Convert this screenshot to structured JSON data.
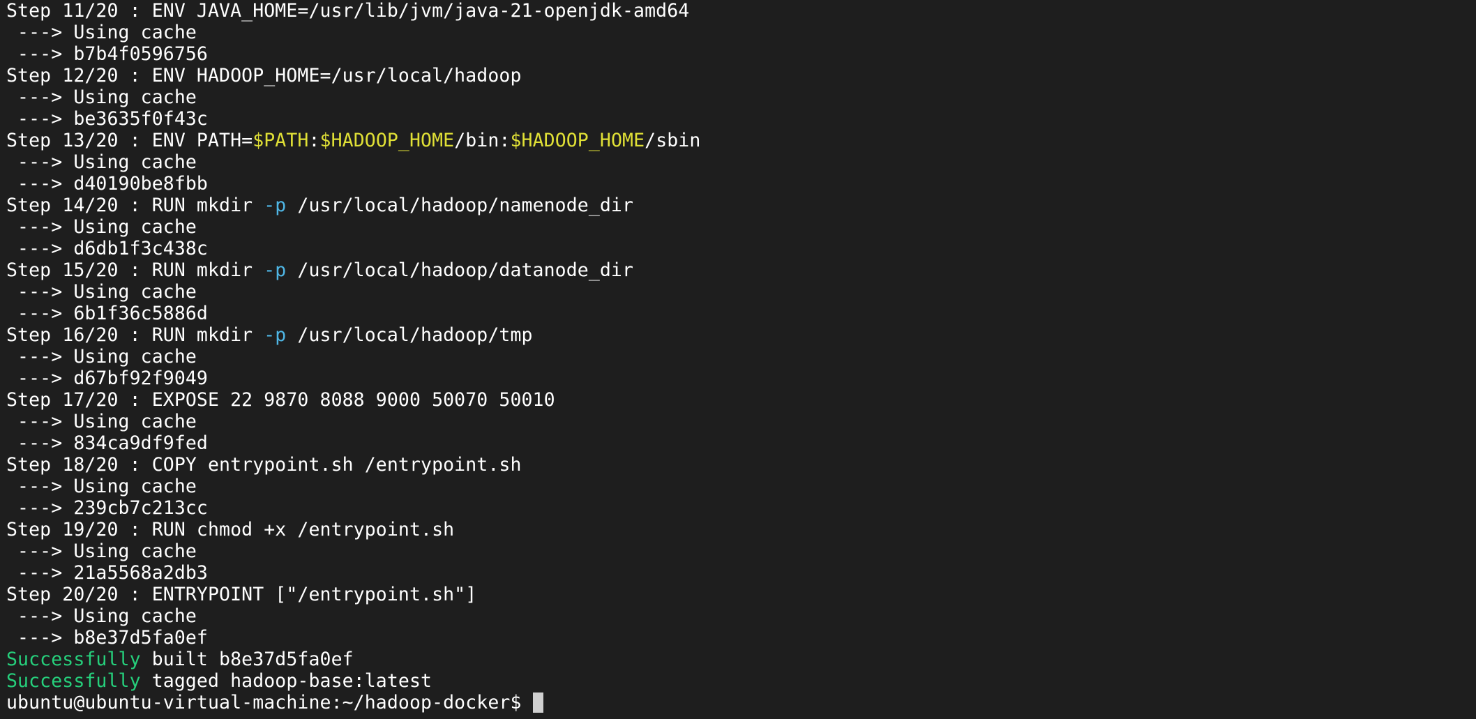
{
  "terminal": {
    "colors": {
      "background": "#1e1e1e",
      "text": "#ffffff",
      "variable": "#e0e036",
      "flag": "#4fb6e5",
      "success": "#26d07c",
      "cursor": "#d0d0d0"
    },
    "lines": [
      [
        {
          "t": "Step 11/20 : ENV JAVA_HOME=/usr/lib/jvm/java-21-openjdk-amd64",
          "c": ""
        }
      ],
      [
        {
          "t": " ---> Using cache",
          "c": ""
        }
      ],
      [
        {
          "t": " ---> b7b4f0596756",
          "c": ""
        }
      ],
      [
        {
          "t": "Step 12/20 : ENV HADOOP_HOME=/usr/local/hadoop",
          "c": ""
        }
      ],
      [
        {
          "t": " ---> Using cache",
          "c": ""
        }
      ],
      [
        {
          "t": " ---> be3635f0f43c",
          "c": ""
        }
      ],
      [
        {
          "t": "Step 13/20 : ENV PATH=",
          "c": ""
        },
        {
          "t": "$PATH",
          "c": "var"
        },
        {
          "t": ":",
          "c": ""
        },
        {
          "t": "$HADOOP_HOME",
          "c": "var"
        },
        {
          "t": "/bin:",
          "c": ""
        },
        {
          "t": "$HADOOP_HOME",
          "c": "var"
        },
        {
          "t": "/sbin",
          "c": ""
        }
      ],
      [
        {
          "t": " ---> Using cache",
          "c": ""
        }
      ],
      [
        {
          "t": " ---> d40190be8fbb",
          "c": ""
        }
      ],
      [
        {
          "t": "Step 14/20 : RUN mkdir ",
          "c": ""
        },
        {
          "t": "-p",
          "c": "flag"
        },
        {
          "t": " /usr/local/hadoop/namenode_dir",
          "c": ""
        }
      ],
      [
        {
          "t": " ---> Using cache",
          "c": ""
        }
      ],
      [
        {
          "t": " ---> d6db1f3c438c",
          "c": ""
        }
      ],
      [
        {
          "t": "Step 15/20 : RUN mkdir ",
          "c": ""
        },
        {
          "t": "-p",
          "c": "flag"
        },
        {
          "t": " /usr/local/hadoop/datanode_dir",
          "c": ""
        }
      ],
      [
        {
          "t": " ---> Using cache",
          "c": ""
        }
      ],
      [
        {
          "t": " ---> 6b1f36c5886d",
          "c": ""
        }
      ],
      [
        {
          "t": "Step 16/20 : RUN mkdir ",
          "c": ""
        },
        {
          "t": "-p",
          "c": "flag"
        },
        {
          "t": " /usr/local/hadoop/tmp",
          "c": ""
        }
      ],
      [
        {
          "t": " ---> Using cache",
          "c": ""
        }
      ],
      [
        {
          "t": " ---> d67bf92f9049",
          "c": ""
        }
      ],
      [
        {
          "t": "Step 17/20 : EXPOSE 22 9870 8088 9000 50070 50010",
          "c": ""
        }
      ],
      [
        {
          "t": " ---> Using cache",
          "c": ""
        }
      ],
      [
        {
          "t": " ---> 834ca9df9fed",
          "c": ""
        }
      ],
      [
        {
          "t": "Step 18/20 : COPY entrypoint.sh /entrypoint.sh",
          "c": ""
        }
      ],
      [
        {
          "t": " ---> Using cache",
          "c": ""
        }
      ],
      [
        {
          "t": " ---> 239cb7c213cc",
          "c": ""
        }
      ],
      [
        {
          "t": "Step 19/20 : RUN chmod +x /entrypoint.sh",
          "c": ""
        }
      ],
      [
        {
          "t": " ---> Using cache",
          "c": ""
        }
      ],
      [
        {
          "t": " ---> 21a5568a2db3",
          "c": ""
        }
      ],
      [
        {
          "t": "Step 20/20 : ENTRYPOINT [\"/entrypoint.sh\"]",
          "c": ""
        }
      ],
      [
        {
          "t": " ---> Using cache",
          "c": ""
        }
      ],
      [
        {
          "t": " ---> b8e37d5fa0ef",
          "c": ""
        }
      ],
      [
        {
          "t": "Successfully",
          "c": "ok"
        },
        {
          "t": " built b8e37d5fa0ef",
          "c": ""
        }
      ],
      [
        {
          "t": "Successfully",
          "c": "ok"
        },
        {
          "t": " tagged hadoop-base:latest",
          "c": ""
        }
      ]
    ],
    "prompt": "ubuntu@ubuntu-virtual-machine:~/hadoop-docker$ "
  }
}
